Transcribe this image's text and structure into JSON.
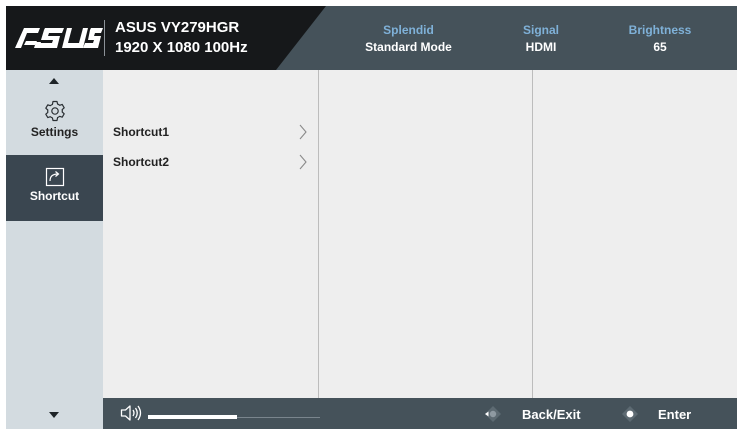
{
  "header": {
    "brand": "ASUS",
    "model_name": "ASUS VY279HGR",
    "resolution": "1920 X 1080 100Hz",
    "status": [
      {
        "label": "Splendid",
        "value": "Standard Mode"
      },
      {
        "label": "Signal",
        "value": "HDMI"
      },
      {
        "label": "Brightness",
        "value": "65"
      }
    ]
  },
  "sidebar": {
    "items": [
      {
        "label": "Settings",
        "icon": "gear-icon",
        "selected": false
      },
      {
        "label": "Shortcut",
        "icon": "shortcut-arrow-icon",
        "selected": true
      }
    ]
  },
  "menu": {
    "items": [
      {
        "label": "Shortcut1",
        "icon": "chevron-right-icon"
      },
      {
        "label": "Shortcut2",
        "icon": "chevron-right-icon"
      }
    ]
  },
  "footer": {
    "volume_icon": "speaker-icon",
    "volume_level": 0.52,
    "back_label": "Back/Exit",
    "enter_label": "Enter"
  },
  "colors": {
    "header_dark": "#16181a",
    "header_slate": "#45525a",
    "accent_label": "#7fb1d8",
    "rail_bg": "#d3dbe0",
    "rail_selected": "#3a4650",
    "panel_bg": "#eeeeee"
  }
}
